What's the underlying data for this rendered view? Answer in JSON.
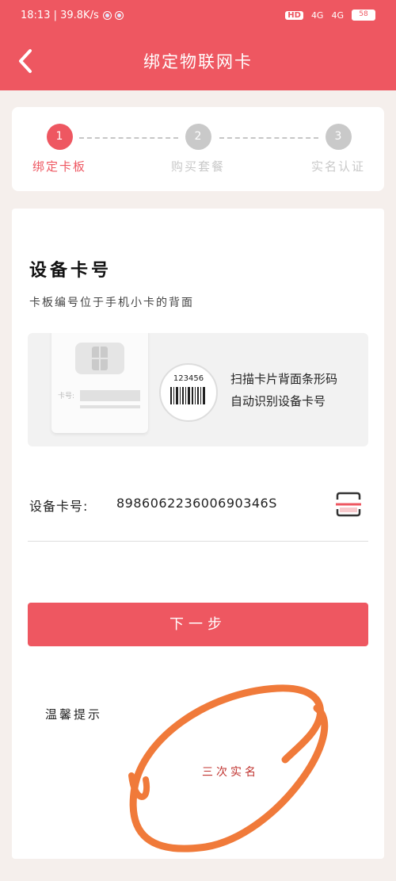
{
  "status_bar": {
    "time_speed": "18:13 | 39.8K/s",
    "hd_label": "HD",
    "signal_label_1": "4G",
    "signal_label_2": "4G",
    "battery_level": "58"
  },
  "header": {
    "title": "绑定物联网卡",
    "back_icon": "back-arrow-icon"
  },
  "steps": [
    {
      "number": "1",
      "label": "绑定卡板",
      "active": true
    },
    {
      "number": "2",
      "label": "购买套餐",
      "active": false
    },
    {
      "number": "3",
      "label": "实名认证",
      "active": false
    }
  ],
  "colors": {
    "accent": "#ee5761",
    "inactive": "#c9c9c9",
    "annotation": "#f07a3a"
  },
  "section": {
    "title": "设备卡号",
    "subtitle": "卡板编号位于手机小卡的背面"
  },
  "scan_banner": {
    "sim_label": "卡号:",
    "barcode_number": "123456",
    "line1": "扫描卡片背面条形码",
    "line2": "自动识别设备卡号"
  },
  "card_field": {
    "label": "设备卡号:",
    "value": "898606223600690346S",
    "scan_icon": "scan-icon"
  },
  "next_button": {
    "label": "下一步"
  },
  "tips": {
    "title": "温馨提示",
    "annotation": "三次实名"
  }
}
